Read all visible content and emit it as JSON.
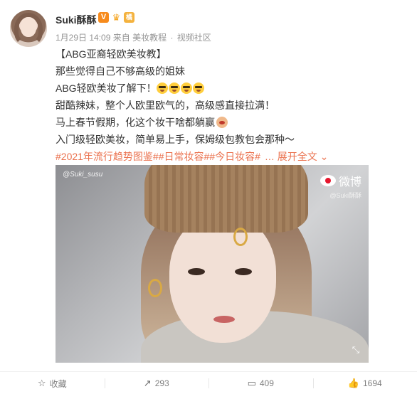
{
  "author": {
    "name": "Suki酥酥",
    "badges": [
      "V",
      "♛",
      "橘"
    ]
  },
  "meta": {
    "date": "1月29日 14:09",
    "source_prefix": "来自",
    "source": "美妆教程",
    "separator": "·",
    "community": "视频社区"
  },
  "content": {
    "lines": [
      "【ABG亚裔轻欧美妆教】",
      "那些觉得自己不够高级的姐妹",
      "ABG轻欧美妆了解下！",
      "甜酷辣妹，整个人欧里欧气的，高级感直接拉满！",
      "马上春节假期，化这个妆干啥都躺赢",
      "入门级轻欧美妆，简单易上手，保姆级包教包会那种～"
    ],
    "tags": [
      "#2021年流行趋势图鉴#",
      "#日常妆容#",
      "#今日妆容#"
    ],
    "expand": "… 展开全文 ⌄"
  },
  "image": {
    "signature": "@Suki_susu",
    "watermark_brand": "微博",
    "watermark_handle": "@Suki酥酥"
  },
  "actions": {
    "favorite": {
      "label": "收藏",
      "icon": "star-icon"
    },
    "repost": {
      "count": "293",
      "icon": "repost-icon"
    },
    "comment": {
      "count": "409",
      "icon": "comment-icon"
    },
    "like": {
      "count": "1694",
      "icon": "thumbs-up-icon"
    }
  },
  "colors": {
    "tag": "#eb7350",
    "meta": "#939393",
    "text": "#333333"
  }
}
